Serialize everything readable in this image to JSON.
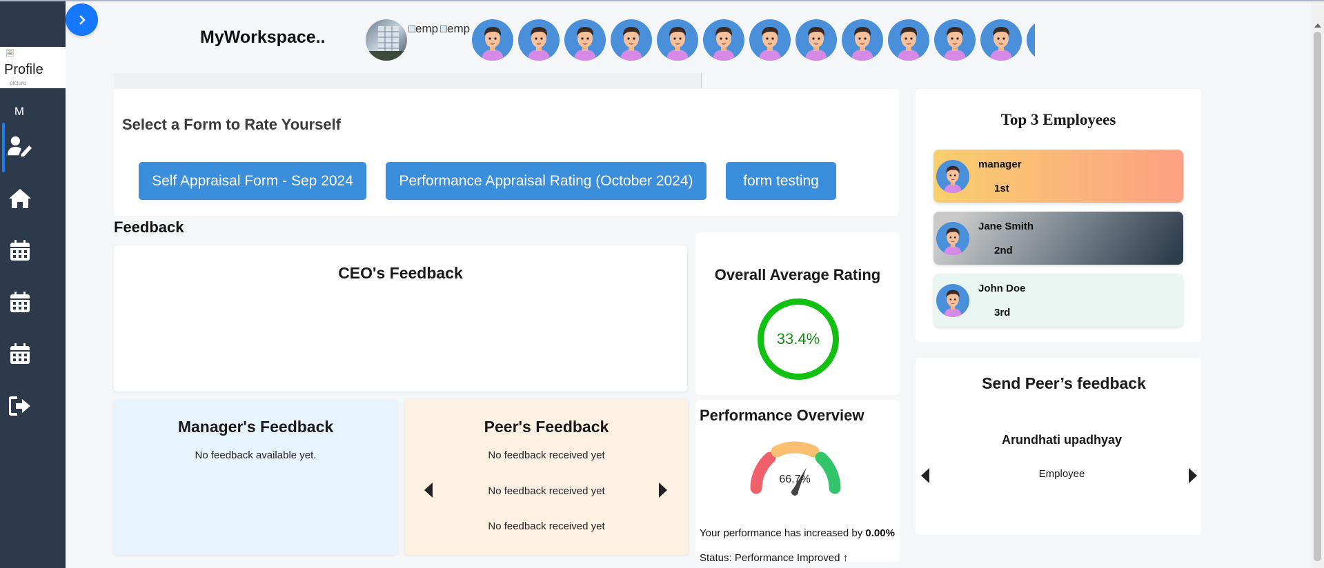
{
  "sidebar": {
    "profile_alt": "Profile",
    "profile_alt_line2": "picture",
    "user_initial": "M",
    "items": [
      {
        "name": "self-rating",
        "icon": "user-edit-icon",
        "active": true
      },
      {
        "name": "home",
        "icon": "home-icon"
      },
      {
        "name": "calendar-1",
        "icon": "calendar-icon"
      },
      {
        "name": "calendar-2",
        "icon": "calendar-icon"
      },
      {
        "name": "calendar-3",
        "icon": "calendar-icon"
      },
      {
        "name": "logout",
        "icon": "logout-icon"
      }
    ]
  },
  "header": {
    "workspace_title": "MyWorkspace..",
    "broken_avatar_alt": "emp"
  },
  "rate_form": {
    "title": "Select a Form to Rate Yourself",
    "buttons": [
      "Self Appraisal Form - Sep 2024",
      "Performance Appraisal Rating (October 2024)",
      "form testing"
    ]
  },
  "feedback": {
    "heading": "Feedback",
    "ceo_title": "CEO's Feedback",
    "manager_title": "Manager's Feedback",
    "manager_empty": "No feedback available yet.",
    "peer_title": "Peer's Feedback",
    "peer_lines": [
      "No feedback received yet",
      "No feedback received yet",
      "No feedback received yet"
    ]
  },
  "average": {
    "title": "Overall Average Rating",
    "value": "33.4%"
  },
  "performance": {
    "title": "Performance Overview",
    "gauge_value": "66.7%",
    "increase_prefix": "Your performance has increased by ",
    "increase_value": "0.00%",
    "status": "Status: Performance Improved ↑"
  },
  "top3": {
    "title": "Top 3 Employees",
    "employees": [
      {
        "name": "manager",
        "rank": "1st"
      },
      {
        "name": "Jane Smith",
        "rank": "2nd"
      },
      {
        "name": "John Doe",
        "rank": "3rd"
      }
    ]
  },
  "peer_send": {
    "title": "Send Peer’s feedback",
    "name": "Arundhati upadhyay",
    "role": "Employee"
  },
  "colors": {
    "sidebar": "#2d3a4b",
    "accent": "#1677ff",
    "form_button": "#3a8edb",
    "rating_ring": "#12c012",
    "gauge_low": "#f0606a",
    "gauge_mid": "#fbbf72",
    "gauge_high": "#33c46a"
  }
}
